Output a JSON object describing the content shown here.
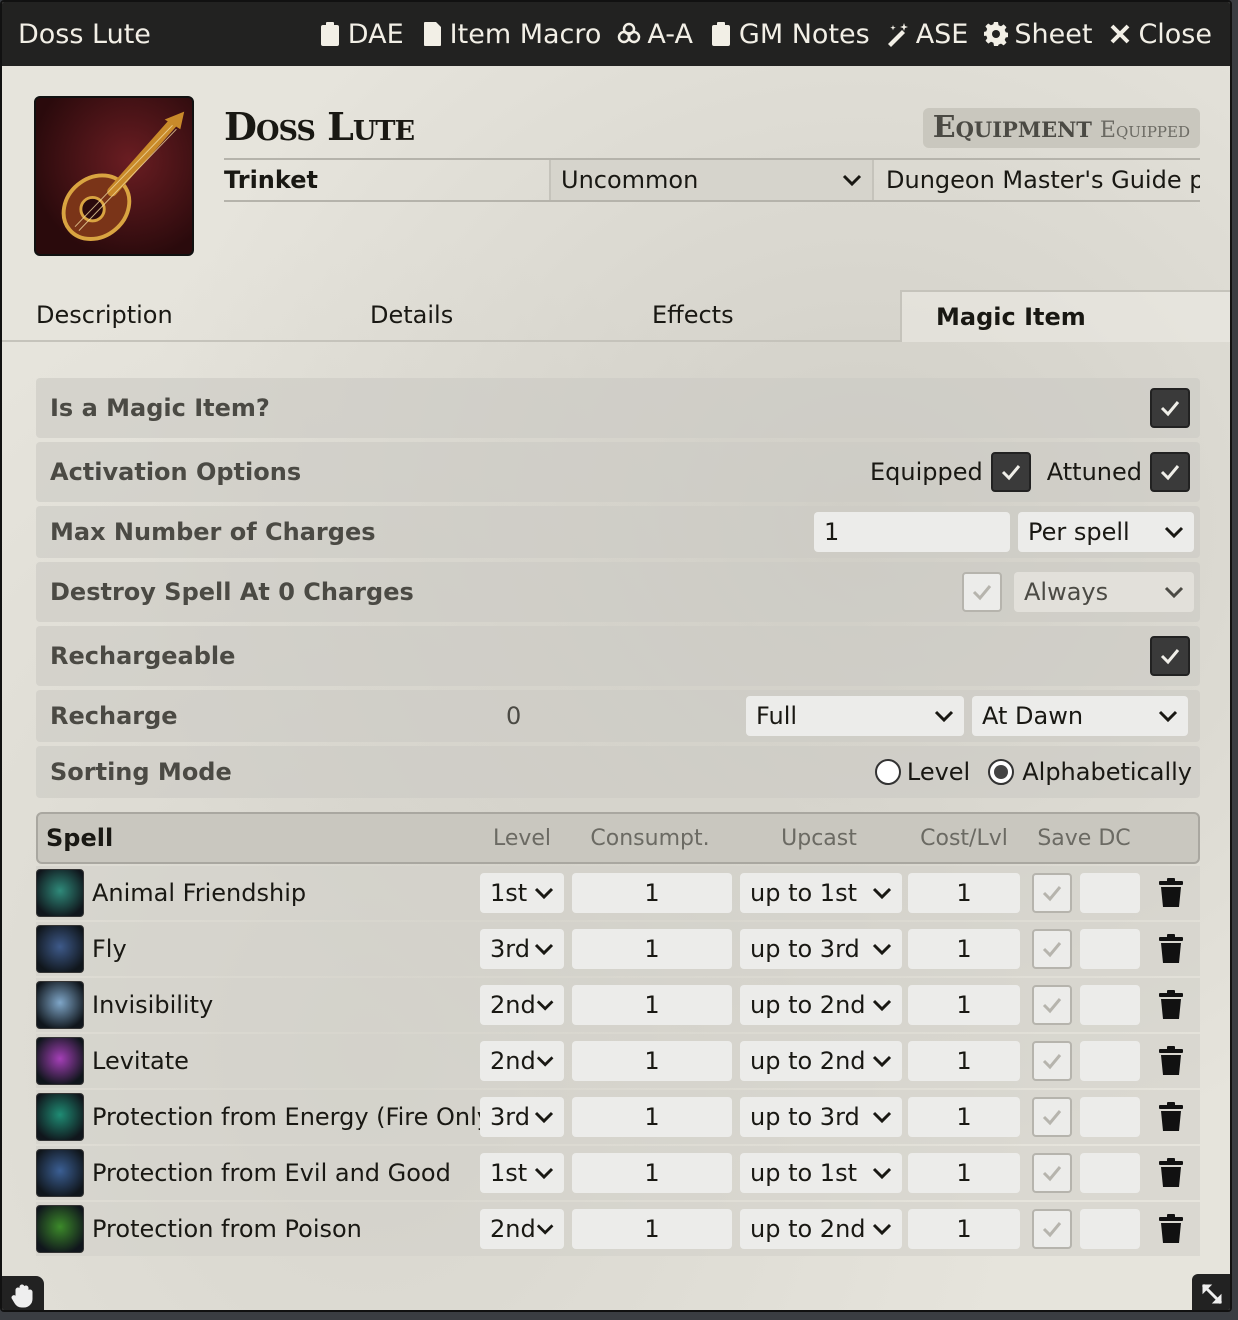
{
  "window": {
    "title": "Doss Lute",
    "actions": [
      {
        "label": "DAE",
        "icon": "clipboard-icon"
      },
      {
        "label": "Item Macro",
        "icon": "sd-card-icon"
      },
      {
        "label": "A-A",
        "icon": "biohazard-icon"
      },
      {
        "label": "GM Notes",
        "icon": "clipboard-icon"
      },
      {
        "label": "ASE",
        "icon": "magic-wand-icon"
      },
      {
        "label": "Sheet",
        "icon": "gear-icon"
      },
      {
        "label": "Close",
        "icon": "close-icon"
      }
    ]
  },
  "item": {
    "name": "Doss Lute",
    "type_label": "Equipment",
    "status_label": "Equipped",
    "subtype": "Trinket",
    "rarity": "Uncommon",
    "source": "Dungeon Master's Guide pg"
  },
  "tabs": [
    "Description",
    "Details",
    "Effects",
    "Magic Item"
  ],
  "active_tab": "Magic Item",
  "magic": {
    "is_magic_label": "Is a Magic Item?",
    "is_magic": true,
    "activation_label": "Activation Options",
    "equipped_label": "Equipped",
    "equipped": true,
    "attuned_label": "Attuned",
    "attuned": true,
    "max_charges_label": "Max Number of Charges",
    "max_charges": "1",
    "charges_mode": "Per spell",
    "destroy_label": "Destroy Spell At 0 Charges",
    "destroy": false,
    "destroy_mode": "Always",
    "rechargeable_label": "Rechargeable",
    "rechargeable": true,
    "recharge_label": "Recharge",
    "recharge_value": "0",
    "recharge_type": "Full",
    "recharge_time": "At Dawn",
    "sorting_label": "Sorting Mode",
    "sort_level_label": "Level",
    "sort_alpha_label": "Alphabetically",
    "sort_mode": "Alphabetically"
  },
  "spell_table": {
    "headers": {
      "spell": "Spell",
      "level": "Level",
      "consumption": "Consumpt.",
      "upcast": "Upcast",
      "cost": "Cost/Lvl",
      "save": "Save DC"
    },
    "rows": [
      {
        "name": "Animal Friendship",
        "level": "1st",
        "consumption": "1",
        "upcast": "up to 1st",
        "cost": "1",
        "icon_color": "#2f8a7a"
      },
      {
        "name": "Fly",
        "level": "3rd",
        "consumption": "1",
        "upcast": "up to 3rd",
        "cost": "1",
        "icon_color": "#3e5a8a"
      },
      {
        "name": "Invisibility",
        "level": "2nd",
        "consumption": "1",
        "upcast": "up to 2nd",
        "cost": "1",
        "icon_color": "#7fa6c8"
      },
      {
        "name": "Levitate",
        "level": "2nd",
        "consumption": "1",
        "upcast": "up to 2nd",
        "cost": "1",
        "icon_color": "#a43fb7"
      },
      {
        "name": "Protection from Energy (Fire Only)",
        "level": "3rd",
        "consumption": "1",
        "upcast": "up to 3rd",
        "cost": "1",
        "icon_color": "#1f8c74"
      },
      {
        "name": "Protection from Evil and Good",
        "level": "1st",
        "consumption": "1",
        "upcast": "up to 1st",
        "cost": "1",
        "icon_color": "#3b5f94"
      },
      {
        "name": "Protection from Poison",
        "level": "2nd",
        "consumption": "1",
        "upcast": "up to 2nd",
        "cost": "1",
        "icon_color": "#3c8a2a"
      }
    ]
  }
}
